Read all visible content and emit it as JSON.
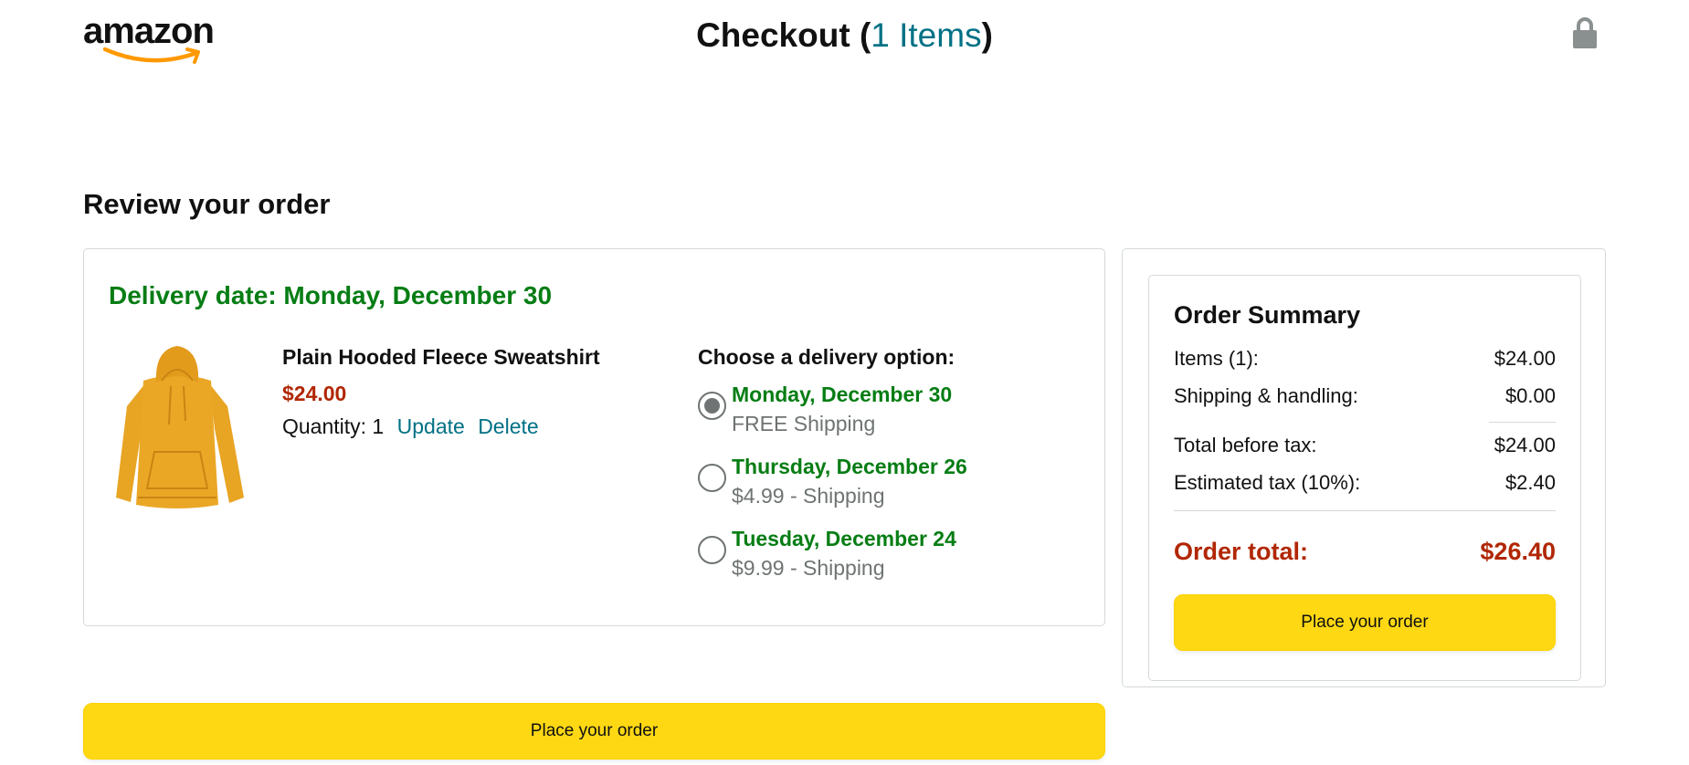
{
  "header": {
    "logo_text": "amazon",
    "checkout_label": "Checkout",
    "items_link": "1 Items",
    "open_paren": "(",
    "close_paren": ")"
  },
  "review": {
    "title": "Review your order"
  },
  "order": {
    "delivery_date": "Delivery date: Monday, December 30",
    "product": {
      "name": "Plain Hooded Fleece Sweatshirt",
      "price": "$24.00",
      "quantity_label": "Quantity: 1",
      "update_label": "Update",
      "delete_label": "Delete",
      "color": "#e8a423"
    },
    "delivery_options_title": "Choose a delivery option:",
    "delivery_options": [
      {
        "date": "Monday, December 30",
        "shipping": "FREE Shipping",
        "selected": true
      },
      {
        "date": "Thursday, December 26",
        "shipping": "$4.99 - Shipping",
        "selected": false
      },
      {
        "date": "Tuesday, December 24",
        "shipping": "$9.99 - Shipping",
        "selected": false
      }
    ]
  },
  "summary": {
    "title": "Order Summary",
    "rows": [
      {
        "label": "Items (1):",
        "value": "$24.00"
      },
      {
        "label": "Shipping & handling:",
        "value": "$0.00"
      },
      {
        "label": "Total before tax:",
        "value": "$24.00"
      },
      {
        "label": "Estimated tax (10%):",
        "value": "$2.40"
      }
    ],
    "total_label": "Order total:",
    "total_value": "$26.40",
    "place_order_label": "Place your order"
  },
  "bottom": {
    "place_order_label": "Place your order"
  },
  "colors": {
    "accent_green": "#067d14",
    "price_red": "#b12704",
    "link_teal": "#007185",
    "button_yellow": "#ffd814"
  }
}
